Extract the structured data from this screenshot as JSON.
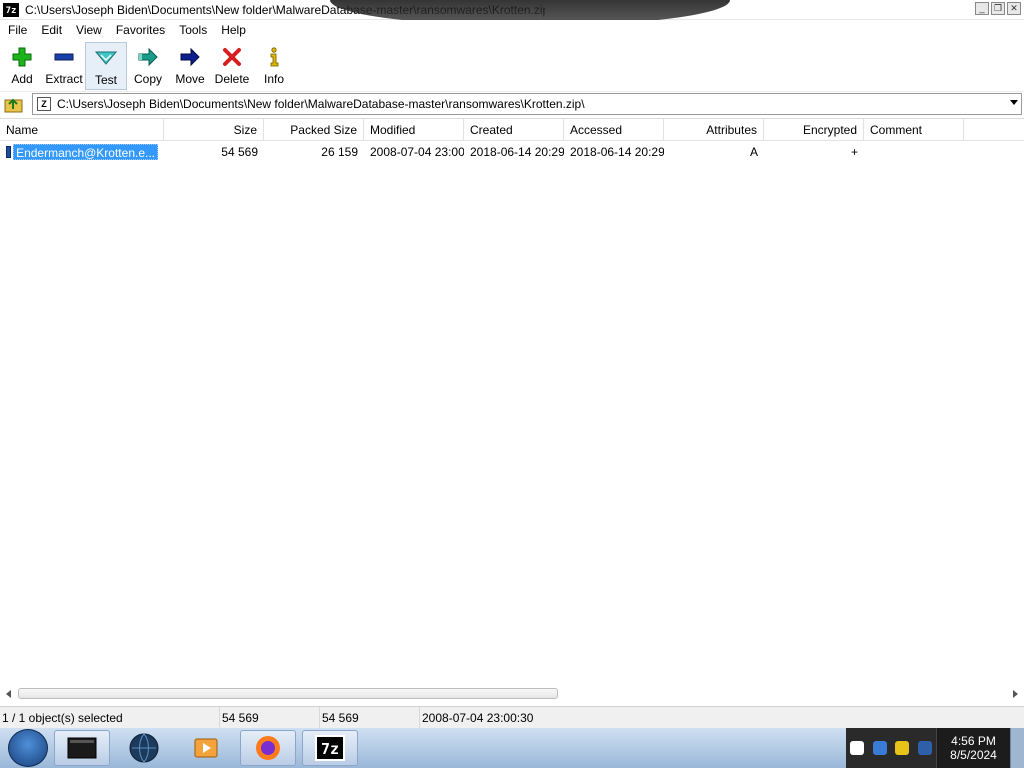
{
  "window": {
    "title": "C:\\Users\\Joseph Biden\\Documents\\New folder\\MalwareDatabase-master\\ransomwares\\Krotten.zip\\",
    "app_icon_text": "7z"
  },
  "menu": [
    "File",
    "Edit",
    "View",
    "Favorites",
    "Tools",
    "Help"
  ],
  "toolbar": {
    "add": "Add",
    "extract": "Extract",
    "test": "Test",
    "copy": "Copy",
    "move": "Move",
    "delete": "Delete",
    "info": "Info"
  },
  "address": {
    "path": "C:\\Users\\Joseph Biden\\Documents\\New folder\\MalwareDatabase-master\\ransomwares\\Krotten.zip\\",
    "zip_icon_text": "Z"
  },
  "columns": {
    "name": "Name",
    "size": "Size",
    "packed": "Packed Size",
    "modified": "Modified",
    "created": "Created",
    "accessed": "Accessed",
    "attributes": "Attributes",
    "encrypted": "Encrypted",
    "comment": "Comment"
  },
  "rows": [
    {
      "name": "Endermanch@Krotten.e...",
      "size": "54 569",
      "packed": "26 159",
      "modified": "2008-07-04 23:00",
      "created": "2018-06-14 20:29",
      "accessed": "2018-06-14 20:29",
      "attributes": "A",
      "encrypted": "+",
      "comment": ""
    }
  ],
  "status": {
    "selected": "1 / 1 object(s) selected",
    "size": "54 569",
    "packed": "54 569",
    "modified": "2008-07-04 23:00:30"
  },
  "taskbar": {
    "time": "4:56 PM",
    "date": "8/5/2024",
    "sevenzip_label": "7z"
  },
  "colors": {
    "selection": "#3399ff",
    "taskbar": "#9ab7d8"
  }
}
